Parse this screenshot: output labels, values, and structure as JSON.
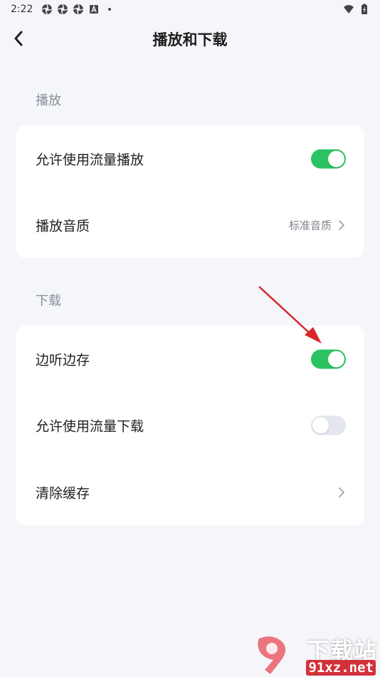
{
  "status_bar": {
    "time": "2:22"
  },
  "header": {
    "title": "播放和下载"
  },
  "sections": [
    {
      "label": "播放",
      "rows": [
        {
          "label": "允许使用流量播放",
          "type": "toggle",
          "on": true
        },
        {
          "label": "播放音质",
          "type": "link",
          "value": "标准音质"
        }
      ]
    },
    {
      "label": "下载",
      "rows": [
        {
          "label": "边听边存",
          "type": "toggle",
          "on": true
        },
        {
          "label": "允许使用流量下载",
          "type": "toggle",
          "on": false
        },
        {
          "label": "清除缓存",
          "type": "link",
          "value": ""
        }
      ]
    }
  ],
  "colors": {
    "accent": "#2bc262",
    "toggle_off": "#e3e6ec",
    "annotation_arrow": "#d8262b"
  },
  "watermark": {
    "main": "下载站",
    "sub": "91xz.net"
  }
}
